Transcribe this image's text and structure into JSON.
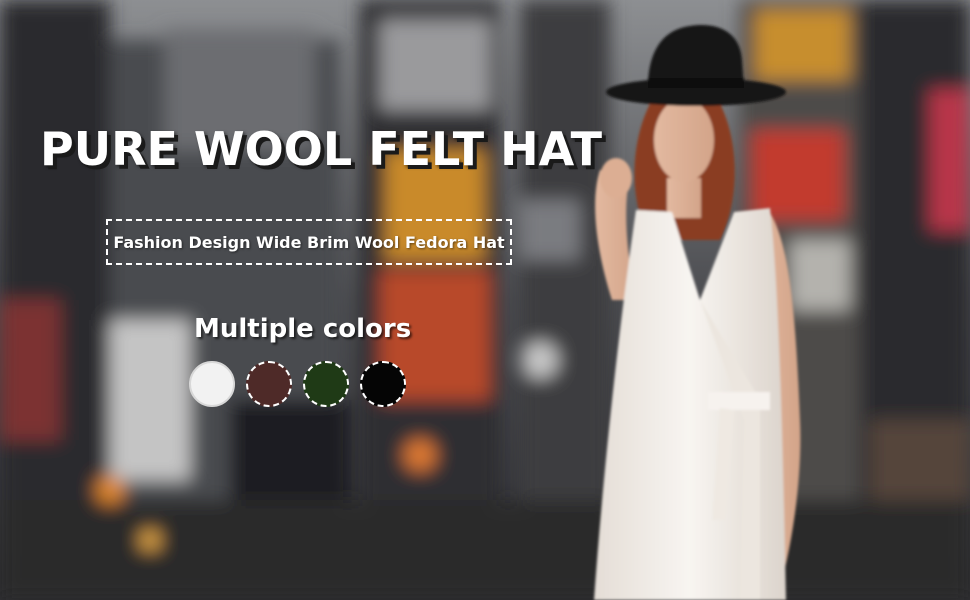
{
  "banner": {
    "title": "PURE WOOL FELT HAT",
    "subtitle": "Fashion Design Wide Brim Wool Fedora Hat",
    "colors_heading": "Multiple colors"
  },
  "swatches": [
    {
      "name": "white",
      "color": "#f2f2f2"
    },
    {
      "name": "brown",
      "color": "#4e2a28"
    },
    {
      "name": "dark-green",
      "color": "#1f3a16"
    },
    {
      "name": "black",
      "color": "#050505"
    }
  ],
  "palette": {
    "text": "#ffffff",
    "dress": "#f3efea",
    "hat": "#151515"
  }
}
